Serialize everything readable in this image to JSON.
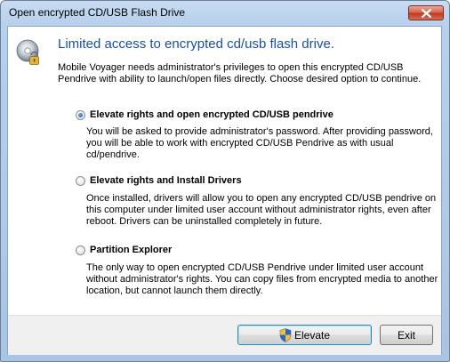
{
  "window": {
    "title": "Open encrypted CD/USB Flash Drive",
    "close_icon": "close-icon"
  },
  "header": {
    "icon": "disc-lock-icon",
    "heading": "Limited access to encrypted cd/usb flash drive.",
    "intro": "Mobile Voyager needs administrator's privileges to open this encrypted CD/USB Pendrive with ability to launch/open files directly. Choose desired option to continue."
  },
  "options": [
    {
      "label": "Elevate rights and open encrypted CD/USB pendrive",
      "selected": true,
      "description": "You will be asked to provide administrator's password. After providing password, you will be able to work with encrypted CD/USB Pendrive as with usual cd/pendrive."
    },
    {
      "label": "Elevate rights and Install Drivers",
      "selected": false,
      "description": "Once installed, drivers will allow you to open any encrypted CD/USB pendrive on this computer under limited user account without administrator rights, even after reboot. Drivers can be uninstalled completely in future."
    },
    {
      "label": "Partition Explorer",
      "selected": false,
      "description": "The only way to open encrypted CD/USB Pendrive under limited user account without administrator's rights. You can copy files from encrypted media to another location, but cannot launch them directly."
    }
  ],
  "footer": {
    "elevate_label": "Elevate",
    "elevate_icon": "uac-shield-icon",
    "exit_label": "Exit"
  },
  "colors": {
    "heading": "#1b4fa0",
    "close_button": "#c23a1f"
  }
}
